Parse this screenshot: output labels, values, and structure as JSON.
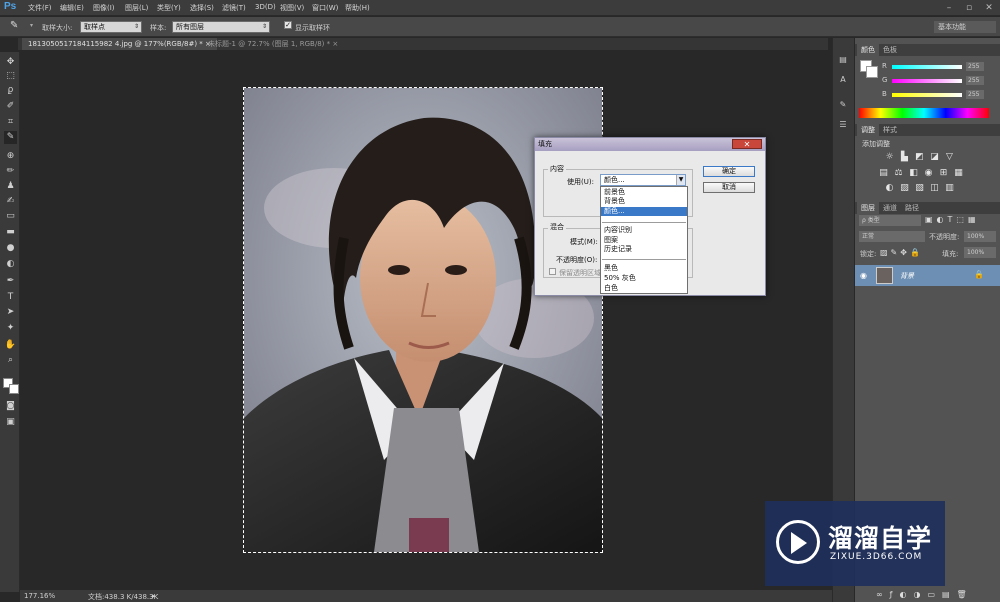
{
  "app": {
    "logo": "Ps"
  },
  "menu": [
    "文件(F)",
    "编辑(E)",
    "图像(I)",
    "图层(L)",
    "类型(Y)",
    "选择(S)",
    "滤镜(T)",
    "3D(D)",
    "视图(V)",
    "窗口(W)",
    "帮助(H)"
  ],
  "options": {
    "sample_size_label": "取样大小:",
    "sample_size_value": "取样点",
    "sample_label": "样本:",
    "sample_value": "所有图层",
    "show_ring_label": "显示取样环",
    "workspace": "基本功能"
  },
  "tabs": [
    {
      "label": "1813050517184115982 4.jpg @ 177%(RGB/8#) *",
      "active": true
    },
    {
      "label": "未标题-1 @ 72.7% (图层 1, RGB/8) *",
      "active": false
    }
  ],
  "status": {
    "zoom": "177.16%",
    "doc": "文档:438.3 K/438.3K"
  },
  "panels": {
    "color_tabs": [
      "颜色",
      "色板"
    ],
    "rgb": [
      {
        "label": "R",
        "value": "255"
      },
      {
        "label": "G",
        "value": "255"
      },
      {
        "label": "B",
        "value": "255"
      }
    ],
    "adjust_tabs": [
      "调整",
      "样式"
    ],
    "adjust_title": "添加调整",
    "layer_tabs": [
      "图层",
      "通道",
      "路径"
    ],
    "kind": "ρ 类型",
    "blend": "正常",
    "opacity_label": "不透明度:",
    "opacity_value": "100%",
    "lock_label": "锁定:",
    "fill_label": "填充:",
    "fill_value": "100%",
    "layer_name": "背景"
  },
  "dialog": {
    "title": "填充",
    "content_group": "内容",
    "use_label": "使用(U):",
    "use_value": "颜色...",
    "blend_group": "混合",
    "mode_label": "模式(M):",
    "opacity_label": "不透明度(O):",
    "preserve_label": "保留透明区域",
    "ok": "确定",
    "cancel": "取消",
    "close": "✕",
    "options": [
      "前景色",
      "背景色",
      "颜色...",
      "内容识别",
      "图案",
      "历史记录",
      "黑色",
      "50% 灰色",
      "白色"
    ],
    "selected": "颜色..."
  },
  "watermark": {
    "brand": "溜溜自学",
    "url": "ZIXUE.3D66.COM"
  },
  "colors": {
    "accent": "#3a78c8",
    "layer_selected": "#6e8fb4",
    "watermark_bg": "#1f2f5a"
  }
}
